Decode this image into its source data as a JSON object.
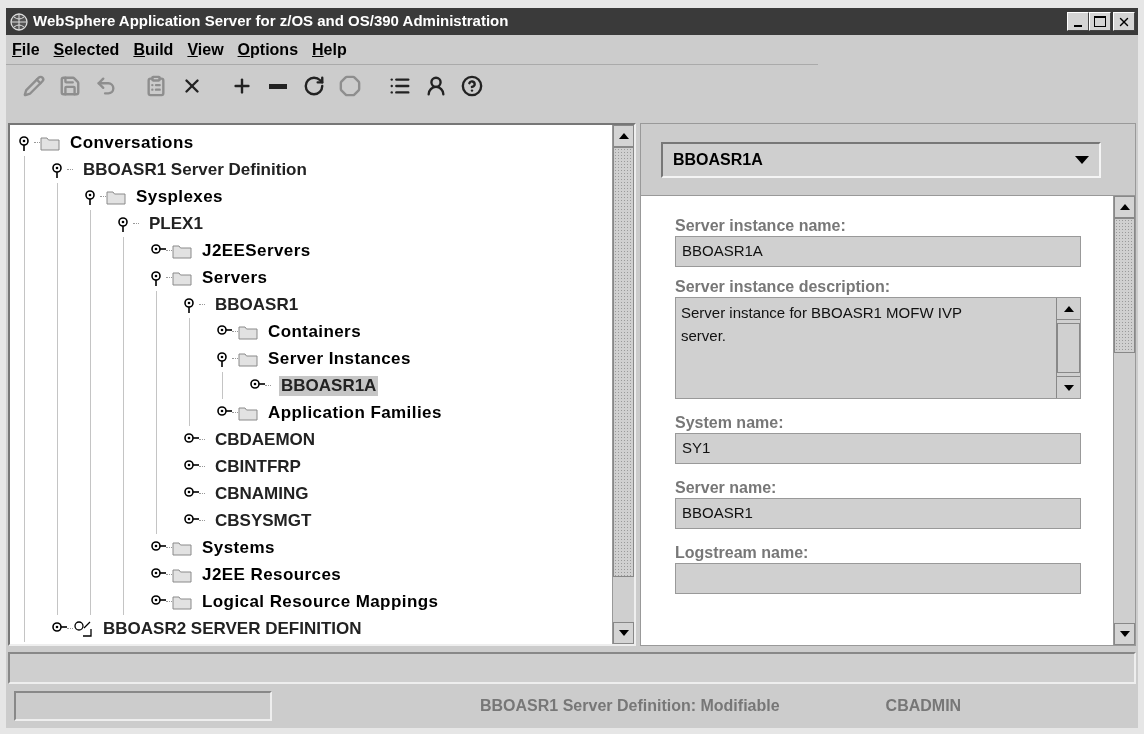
{
  "window": {
    "title": "WebSphere Application Server for z/OS and OS/390 Administration"
  },
  "menu": [
    "File",
    "Selected",
    "Build",
    "View",
    "Options",
    "Help"
  ],
  "toolbar": [
    {
      "disabled": true
    },
    {
      "disabled": true
    },
    {
      "disabled": true
    },
    {
      "disabled": true
    },
    {
      "disabled": false
    },
    {
      "disabled": false
    },
    {
      "disabled": false
    },
    {
      "disabled": false
    },
    {
      "disabled": true
    },
    {
      "disabled": false
    },
    {
      "disabled": false
    },
    {
      "disabled": false
    }
  ],
  "tree": [
    {
      "label": "Conversations",
      "kind": "folder",
      "expanded": true,
      "selected": false,
      "children": [
        {
          "label": "BBOASR1 Server Definition",
          "expanded": true,
          "selected": false,
          "children": [
            {
              "label": "Sysplexes",
              "kind": "folder",
              "expanded": true,
              "selected": false,
              "children": [
                {
                  "label": "PLEX1",
                  "expanded": true,
                  "selected": false,
                  "children": [
                    {
                      "label": "J2EEServers",
                      "kind": "folder",
                      "expanded": false,
                      "selected": false
                    },
                    {
                      "label": "Servers",
                      "kind": "folder",
                      "expanded": true,
                      "selected": false,
                      "children": [
                        {
                          "label": "BBOASR1",
                          "expanded": true,
                          "selected": false,
                          "children": [
                            {
                              "label": "Containers",
                              "kind": "folder",
                              "expanded": false,
                              "selected": false
                            },
                            {
                              "label": "Server Instances",
                              "kind": "folder",
                              "expanded": true,
                              "selected": false,
                              "children": [
                                {
                                  "label": "BBOASR1A",
                                  "expanded": false,
                                  "selected": true
                                }
                              ]
                            },
                            {
                              "label": "Application Families",
                              "kind": "folder",
                              "expanded": false,
                              "selected": false
                            }
                          ]
                        },
                        {
                          "label": "CBDAEMON",
                          "expanded": false,
                          "selected": false
                        },
                        {
                          "label": "CBINTFRP",
                          "expanded": false,
                          "selected": false
                        },
                        {
                          "label": "CBNAMING",
                          "expanded": false,
                          "selected": false
                        },
                        {
                          "label": "CBSYSMGT",
                          "expanded": false,
                          "selected": false
                        }
                      ]
                    },
                    {
                      "label": "Systems",
                      "kind": "folder",
                      "expanded": false,
                      "selected": false
                    },
                    {
                      "label": "J2EE Resources",
                      "kind": "folder",
                      "expanded": false,
                      "selected": false
                    },
                    {
                      "label": "Logical Resource Mappings",
                      "kind": "folder",
                      "expanded": false,
                      "selected": false
                    }
                  ]
                }
              ]
            }
          ]
        },
        {
          "label": "BBOASR2 SERVER DEFINITION",
          "kind": "definition",
          "expanded": false,
          "selected": false
        }
      ]
    }
  ],
  "detail": {
    "selector": "BBOASR1A",
    "fields": [
      {
        "label": "Server instance name:",
        "kind": "text",
        "value": "BBOASR1A"
      },
      {
        "label": "Server instance description:",
        "kind": "textarea",
        "value": "Server instance for BBOASR1 MOFW IVP server."
      },
      {
        "label": "System name:",
        "kind": "text",
        "value": "SY1"
      },
      {
        "label": "Server name:",
        "kind": "text",
        "value": "BBOASR1"
      },
      {
        "label": "Logstream name:",
        "kind": "text"
      }
    ]
  },
  "status_bar": {
    "state": "BBOASR1 Server Definition: Modifiable",
    "user": "CBADMIN"
  }
}
